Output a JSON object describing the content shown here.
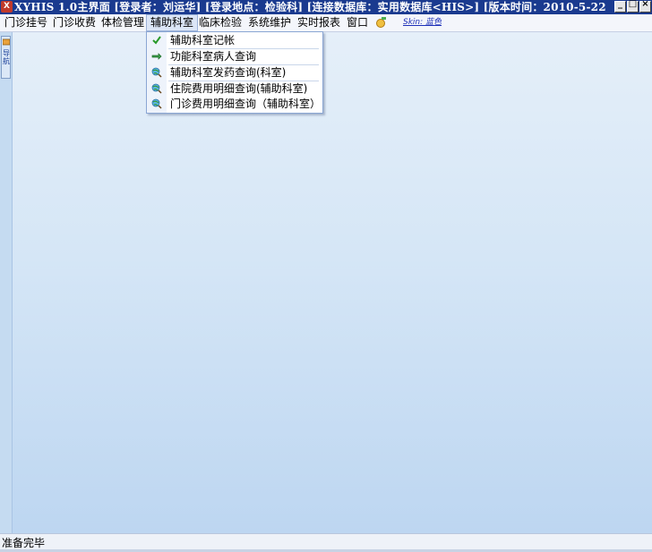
{
  "window": {
    "title": "XYHIS 1.0主界面   [登录者：刘运华]  [登录地点：检验科]  [连接数据库：实用数据库<HIS>]  [版本时间：2010-5-22 ...",
    "app_icon_text": "X",
    "minimize_label": "_",
    "maximize_label": "□",
    "close_label": "×"
  },
  "menu": {
    "items": [
      {
        "label": "门诊挂号"
      },
      {
        "label": "门诊收费"
      },
      {
        "label": "体检管理"
      },
      {
        "label": "辅助科室"
      },
      {
        "label": "临床检验"
      },
      {
        "label": "系统维护"
      },
      {
        "label": "实时报表"
      },
      {
        "label": "窗口"
      }
    ],
    "skin_link": "Skin: 蓝色"
  },
  "dropdown": {
    "items": [
      {
        "label": "辅助科室记帐",
        "icon": "checkmark-icon"
      },
      {
        "label": "功能科室病人查询",
        "icon": "hand-pointer-icon"
      },
      {
        "label": "辅助科室发药查询(科室)",
        "icon": "globe-search-icon"
      },
      {
        "label": "住院费用明细查询(辅助科室)",
        "icon": "globe-search-icon"
      },
      {
        "label": "门诊费用明细查询（辅助科室）",
        "icon": "globe-search-icon"
      }
    ]
  },
  "side_tab": {
    "label": "导航"
  },
  "status": {
    "text": "准备完毕"
  },
  "colors": {
    "title_bg": "#1a3a8f",
    "menu_bg": "#f4f6fb",
    "workspace_top": "#e5eff9",
    "workspace_bottom": "#bdd6f1",
    "skin_link": "#1c2fb8"
  }
}
